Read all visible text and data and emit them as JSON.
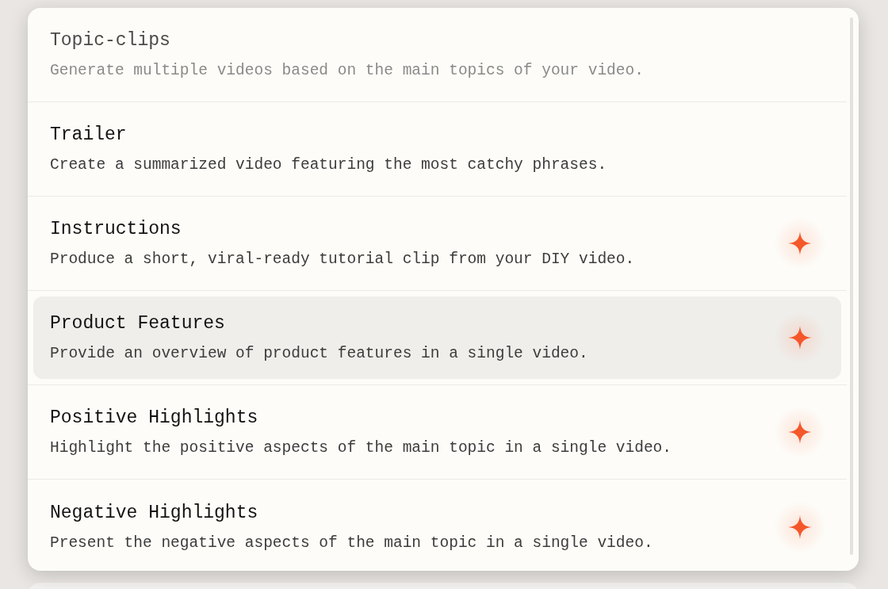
{
  "items": [
    {
      "title": "Topic-clips",
      "description": "Generate multiple videos based on the main topics of your video.",
      "disabled": true,
      "selected": false,
      "sparkle": false
    },
    {
      "title": "Trailer",
      "description": "Create a summarized video featuring the most catchy phrases.",
      "disabled": false,
      "selected": false,
      "sparkle": false
    },
    {
      "title": "Instructions",
      "description": "Produce a short, viral-ready tutorial clip from your DIY video.",
      "disabled": false,
      "selected": false,
      "sparkle": true
    },
    {
      "title": "Product Features",
      "description": "Provide an overview of product features in a single video.",
      "disabled": false,
      "selected": true,
      "sparkle": true
    },
    {
      "title": "Positive Highlights",
      "description": "Highlight the positive aspects of the main topic in a single video.",
      "disabled": false,
      "selected": false,
      "sparkle": true
    },
    {
      "title": "Negative Highlights",
      "description": "Present the negative aspects of the main topic in a single video.",
      "disabled": false,
      "selected": false,
      "sparkle": true
    }
  ]
}
